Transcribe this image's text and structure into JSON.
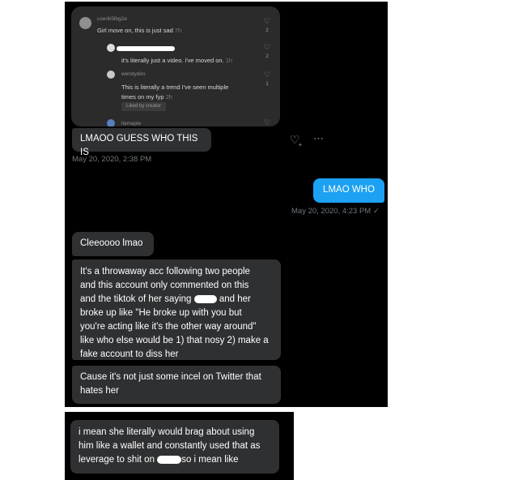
{
  "tiktok": {
    "comments": [
      {
        "user": "userik5lbg2e",
        "text": "Girl move on, this is just sad",
        "time": "7h",
        "likes": "2"
      },
      {
        "user": "",
        "text": "it's literally just a video. i've moved on.",
        "time": "1h",
        "likes": "2"
      },
      {
        "user": "wendydiro",
        "text": "This is literally a trend I've seen multiple",
        "text2": "times on my fyp",
        "time": "2h",
        "likes": "1",
        "badge": "Liked by creator"
      },
      {
        "user": "llamapie",
        "text": "",
        "time": "",
        "likes": ""
      }
    ]
  },
  "messages": {
    "m1": {
      "text": "LMAOO GUESS WHO THIS IS",
      "time": "May 20, 2020, 2:38 PM"
    },
    "m2": {
      "text": "LMAO WHO",
      "time": "May 20, 2020, 4:23 PM ✓"
    },
    "m3": {
      "text": "Cleeoooo lmao"
    },
    "m4": {
      "l1": "It's a throwaway acc following two people",
      "l2": "and this account only commented on this",
      "l3a": "and the tiktok of her saying",
      "l3b": "and her",
      "l4": "broke up like \"He broke up with you but",
      "l5": "you're acting like it's the other way around\"",
      "l6": "like who else would be 1) that nosy 2) make a",
      "l7": "fake account to diss her"
    },
    "m5": {
      "l1": "Cause it's not just some incel on Twitter that",
      "l2": "hates her"
    },
    "m6": {
      "l1": "i mean she literally would brag about using",
      "l2": "him like a wallet and constantly used that as",
      "l3a": "leverage to shit on",
      "l3b": "so i mean like"
    }
  },
  "icons": {
    "react": "heart-plus-icon",
    "more": "more-icon"
  },
  "colors": {
    "incoming": "#2f3032",
    "outgoing": "#1da1f2",
    "timestamp": "#6e767d"
  }
}
